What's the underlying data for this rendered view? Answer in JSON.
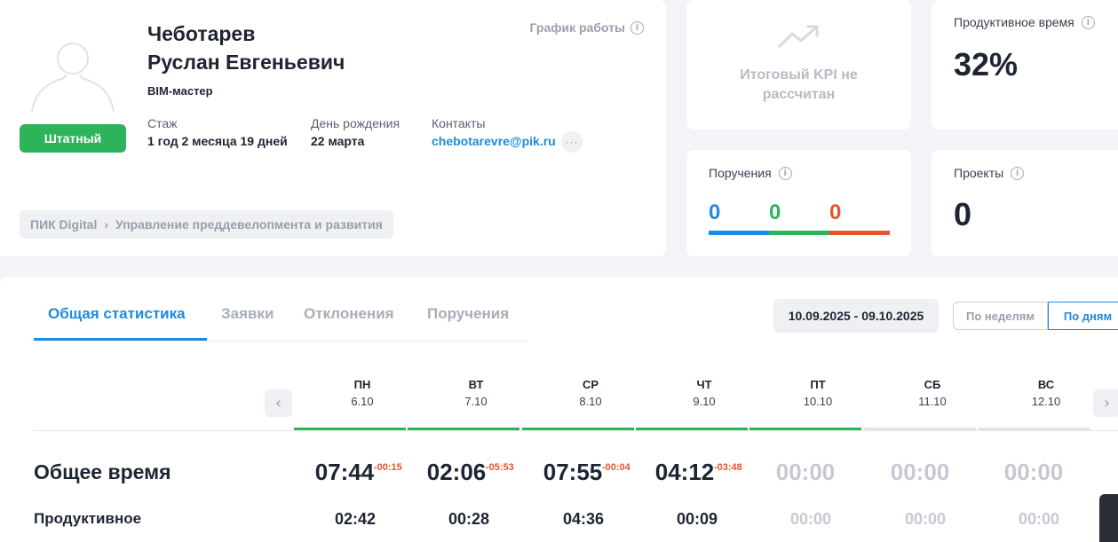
{
  "profile": {
    "last_name": "Чеботарев",
    "first_names": "Руслан Евгеньевич",
    "position": "BIM-мастер",
    "status_badge": "Штатный",
    "schedule_label": "График работы",
    "experience_label": "Стаж",
    "experience_value": "1 год 2 месяца 19 дней",
    "birthday_label": "День рождения",
    "birthday_value": "22 марта",
    "contacts_label": "Контакты",
    "email": "chebotarevre@pik.ru",
    "more_label": "···",
    "breadcrumb": [
      "ПИК Digital",
      "Управление преддевелопмента и развития"
    ],
    "breadcrumb_sep": "›"
  },
  "kpi": {
    "text_line1": "Итоговый KPI не",
    "text_line2": "рассчитан"
  },
  "productive_time": {
    "title": "Продуктивное время",
    "value": "32%"
  },
  "orders": {
    "title": "Поручения",
    "values": [
      "0",
      "0",
      "0"
    ],
    "colors": [
      "#1f8be0",
      "#2db35a",
      "#e8532f"
    ]
  },
  "projects": {
    "title": "Проекты",
    "value": "0"
  },
  "tabs": [
    "Общая статистика",
    "Заявки",
    "Отклонения",
    "Поручения"
  ],
  "active_tab": 0,
  "date_range": "10.09.2025 - 09.10.2025",
  "period_toggle": {
    "weeks": "По неделям",
    "days": "По дням",
    "active": "days"
  },
  "days": [
    {
      "name": "ПН",
      "date": "6.10",
      "total": "07:44",
      "deviation": "-00:15",
      "productive": "02:42",
      "worked": true
    },
    {
      "name": "ВТ",
      "date": "7.10",
      "total": "02:06",
      "deviation": "-05:53",
      "productive": "00:28",
      "worked": true
    },
    {
      "name": "СР",
      "date": "8.10",
      "total": "07:55",
      "deviation": "-00:04",
      "productive": "04:36",
      "worked": true
    },
    {
      "name": "ЧТ",
      "date": "9.10",
      "total": "04:12",
      "deviation": "-03:48",
      "productive": "00:09",
      "worked": true
    },
    {
      "name": "ПТ",
      "date": "10.10",
      "total": "00:00",
      "deviation": "",
      "productive": "00:00",
      "worked": true
    },
    {
      "name": "СБ",
      "date": "11.10",
      "total": "00:00",
      "deviation": "",
      "productive": "00:00",
      "worked": false
    },
    {
      "name": "ВС",
      "date": "12.10",
      "total": "00:00",
      "deviation": "",
      "productive": "00:00",
      "worked": false
    }
  ],
  "rows": {
    "total_label": "Общее время",
    "productive_label": "Продуктивное"
  },
  "icons": {
    "prev": "chevron-left-icon",
    "next": "chevron-right-icon",
    "info": "info-icon",
    "trend": "trend-up-icon",
    "avatar": "user-placeholder-icon"
  }
}
